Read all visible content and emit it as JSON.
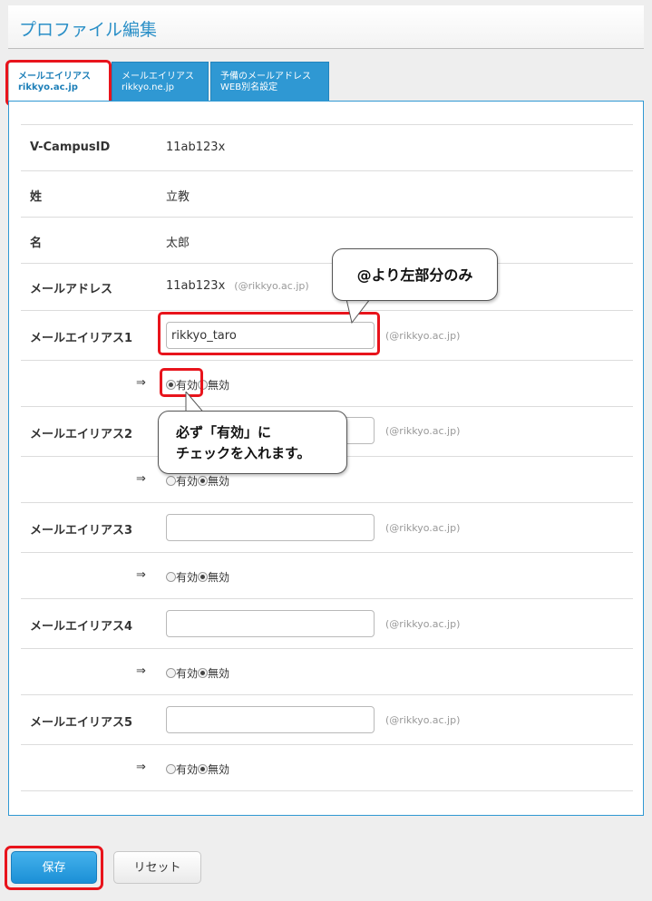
{
  "header": {
    "title": "プロファイル編集"
  },
  "tabs": [
    {
      "line1": "メールエイリアス",
      "line2": "rikkyo.ac.jp"
    },
    {
      "line1": "メールエイリアス",
      "line2": "rikkyo.ne.jp"
    },
    {
      "line1": "予備のメールアドレス",
      "line2": "WEB別名設定"
    }
  ],
  "info": {
    "vcampus_label": "V-CampusID",
    "vcampus_value": "11ab123x",
    "sei_label": "姓",
    "sei_value": "立教",
    "mei_label": "名",
    "mei_value": "太郎",
    "mail_label": "メールアドレス",
    "mail_value": "11ab123x",
    "mail_domain": "(@rikkyo.ac.jp)"
  },
  "alias": {
    "domain": "(@rikkyo.ac.jp)",
    "arrow": "⇒",
    "enabled_label": "有効",
    "disabled_label": "無効",
    "items": [
      {
        "label": "メールエイリアス1",
        "value": "rikkyo_taro"
      },
      {
        "label": "メールエイリアス2",
        "value": ""
      },
      {
        "label": "メールエイリアス3",
        "value": ""
      },
      {
        "label": "メールエイリアス4",
        "value": ""
      },
      {
        "label": "メールエイリアス5",
        "value": ""
      }
    ]
  },
  "callouts": {
    "left_part": "@より左部分のみ",
    "check_line1": "必ず「有効」に",
    "check_line2": "チェックを入れます。"
  },
  "buttons": {
    "save": "保存",
    "reset": "リセット"
  },
  "colors": {
    "accent": "#2f98d3",
    "highlight": "#e8141c"
  }
}
